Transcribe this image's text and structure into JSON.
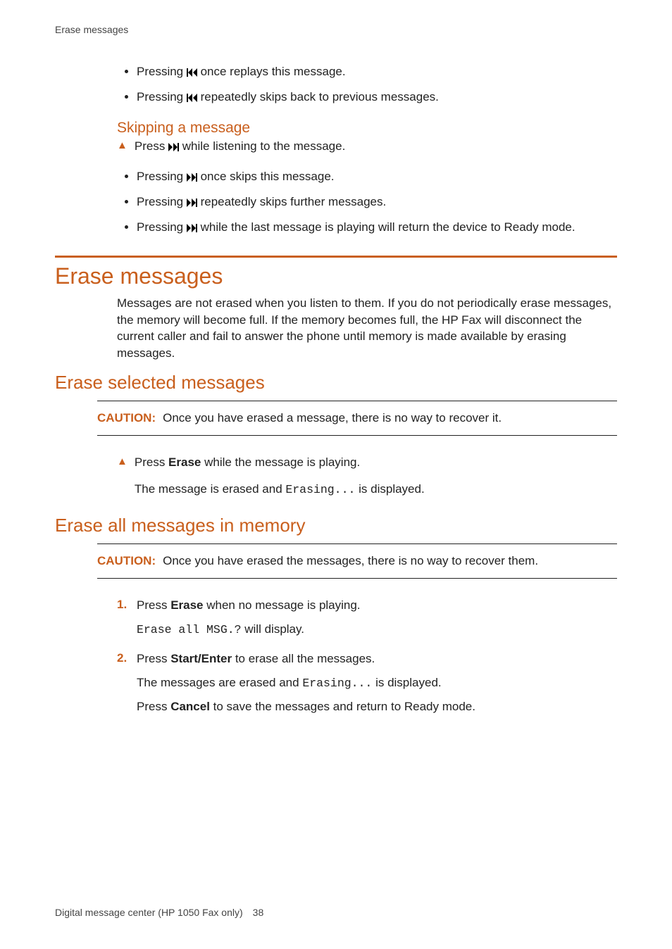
{
  "runningHead": "Erase messages",
  "intro_bullets": [
    {
      "pre": "Pressing ",
      "icon": "rewind",
      "post": " once replays this message."
    },
    {
      "pre": "Pressing ",
      "icon": "rewind",
      "post": " repeatedly skips back to previous messages."
    }
  ],
  "skipping": {
    "heading": "Skipping a message",
    "step_pre": "Press ",
    "step_icon": "fwd",
    "step_post": " while listening to the message.",
    "bullets": [
      {
        "pre": "Pressing ",
        "icon": "fwd",
        "post": " once skips this message."
      },
      {
        "pre": "Pressing ",
        "icon": "fwd",
        "post": " repeatedly skips further messages."
      },
      {
        "pre": "Pressing ",
        "icon": "fwd",
        "post": " while the last message is playing will return the device to Ready mode."
      }
    ]
  },
  "erase": {
    "h1": "Erase messages",
    "para": "Messages are not erased when you listen to them. If you do not periodically erase messages, the memory will become full. If the memory becomes full, the HP Fax will disconnect the current caller and fail to answer the phone until memory is made available by erasing messages."
  },
  "selected": {
    "h2": "Erase selected messages",
    "caution_label": "CAUTION:",
    "caution_text": "Once you have erased a message, there is no way to recover it.",
    "step_pre": "Press ",
    "step_bold": "Erase",
    "step_post": " while the message is playing.",
    "result_pre": "The message is erased and ",
    "result_mono": "Erasing...",
    "result_post": " is displayed."
  },
  "all": {
    "h2": "Erase all messages in memory",
    "caution_label": "CAUTION:",
    "caution_text": "Once you have erased the messages, there is no way to recover them.",
    "steps": [
      {
        "num": "1.",
        "line_pre": "Press ",
        "line_bold": "Erase",
        "line_post": " when no message is playing.",
        "sub_mono": "Erase all MSG.?",
        "sub_post": " will display."
      },
      {
        "num": "2.",
        "line_pre": "Press ",
        "line_bold": "Start/Enter",
        "line_post": " to erase all the messages.",
        "sub1_pre": "The messages are erased and ",
        "sub1_mono": "Erasing...",
        "sub1_post": " is displayed.",
        "sub2_pre": "Press ",
        "sub2_bold": "Cancel",
        "sub2_post": " to save the messages and return to Ready mode."
      }
    ]
  },
  "footer": {
    "chapter": "Digital message center (HP 1050 Fax only)",
    "page": "38"
  },
  "triangle": "▲"
}
